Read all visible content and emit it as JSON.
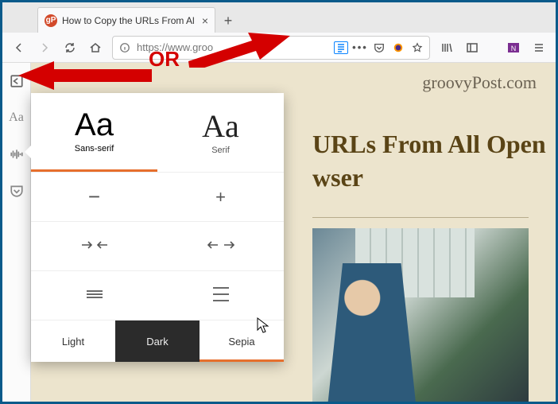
{
  "tab": {
    "title": "How to Copy the URLs From Al",
    "favicon_letter": "gP"
  },
  "url": "https://www.groo",
  "sidebar_aa": "Aa",
  "page": {
    "brand": "groovyPost.com",
    "title_line1": "URLs From All Open",
    "title_line2": "wser"
  },
  "reader": {
    "sans_sample": "Aa",
    "sans_label": "Sans-serif",
    "serif_sample": "Aa",
    "serif_label": "Serif",
    "minus": "−",
    "plus": "+",
    "light": "Light",
    "dark": "Dark",
    "sepia": "Sepia"
  },
  "annotation": {
    "or": "OR"
  }
}
